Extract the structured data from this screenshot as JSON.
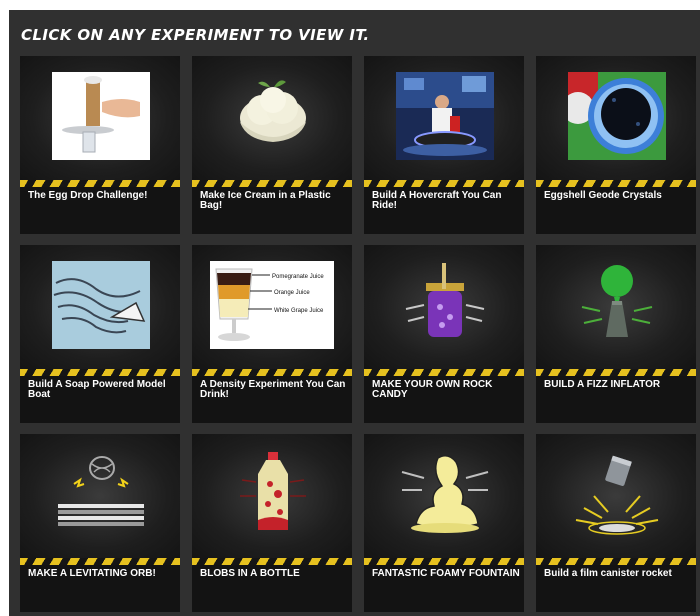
{
  "page": {
    "title": "CLICK ON ANY EXPERIMENT TO VIEW IT."
  },
  "experiments": [
    {
      "label": "The Egg Drop Challenge!",
      "thumbnail": "egg-drop-photo"
    },
    {
      "label": "Make Ice Cream in a Plastic Bag!",
      "thumbnail": "ice-cream-bowl-photo"
    },
    {
      "label": "Build A Hovercraft You Can Ride!",
      "thumbnail": "hovercraft-photo"
    },
    {
      "label": "Eggshell Geode Crystals",
      "thumbnail": "geode-crystals-photo"
    },
    {
      "label": "Build A Soap Powered Model Boat",
      "thumbnail": "soap-boat-illustration"
    },
    {
      "label": "A Density Experiment You Can Drink!",
      "thumbnail": "density-drink-photo",
      "thumbnail_labels": [
        "Pomegranate Juice",
        "Orange Juice",
        "White Grape Juice"
      ]
    },
    {
      "label": "MAKE YOUR OWN ROCK CANDY",
      "thumbnail": "rock-candy-jar-icon"
    },
    {
      "label": "BUILD A FIZZ INFLATOR",
      "thumbnail": "fizz-inflator-balloon-icon"
    },
    {
      "label": "MAKE A LEVITATING ORB!",
      "thumbnail": "levitating-orb-icon"
    },
    {
      "label": "BLOBS IN A BOTTLE",
      "thumbnail": "lava-bottle-icon"
    },
    {
      "label": "FANTASTIC FOAMY FOUNTAIN",
      "thumbnail": "foam-fountain-icon"
    },
    {
      "label": "Build a film canister rocket",
      "thumbnail": "film-canister-rocket-icon"
    }
  ],
  "colors": {
    "background": "#303030",
    "card": "#131313",
    "hazard_yellow": "#e6c11f",
    "text": "#ffffff"
  }
}
